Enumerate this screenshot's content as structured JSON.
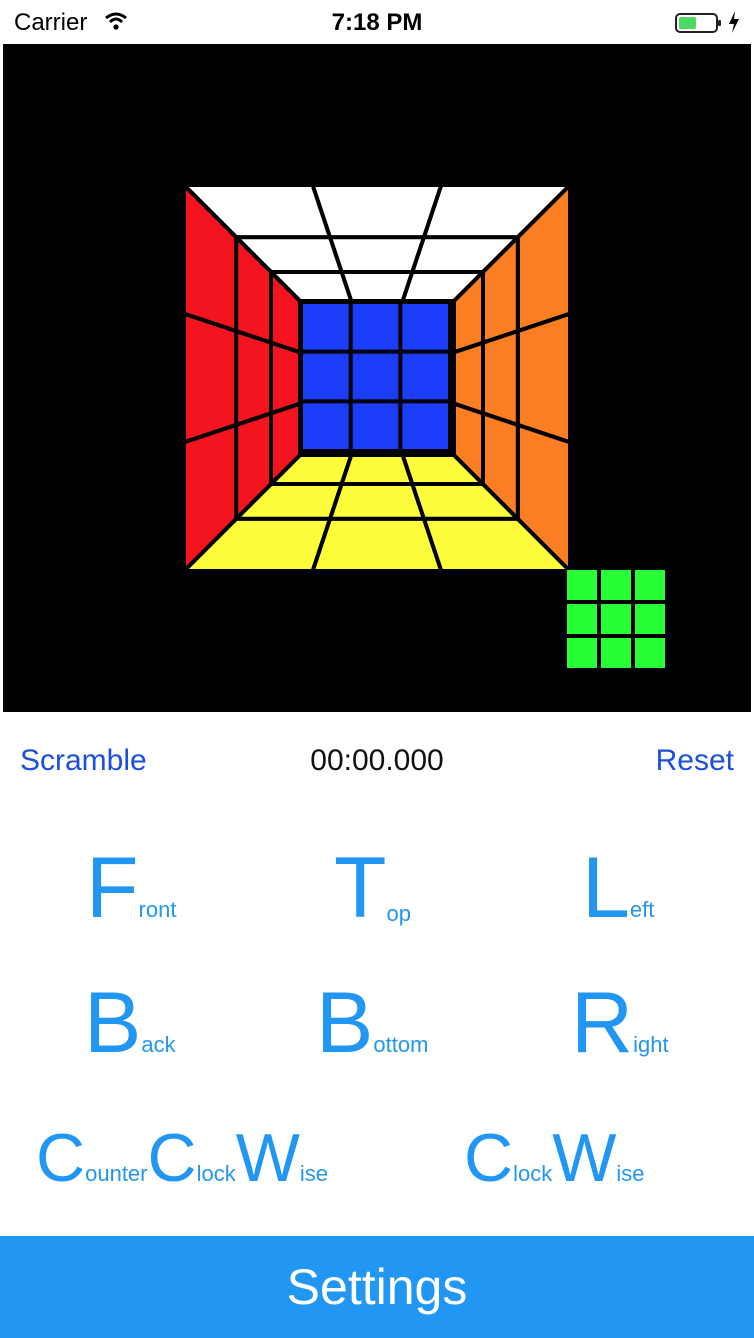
{
  "status_bar": {
    "carrier": "Carrier",
    "time": "7:18 PM"
  },
  "faces": {
    "top": "#ffffff",
    "left": "#f41420",
    "right": "#fb7f22",
    "bottom": "#fdfd3c",
    "center": "#1b3cf8",
    "mini": "#27fe35"
  },
  "controls": {
    "scramble": "Scramble",
    "timer": "00:00.000",
    "reset": "Reset"
  },
  "moves": {
    "front": {
      "big": "F",
      "small": "ront"
    },
    "top": {
      "big": "T",
      "small": "op"
    },
    "left": {
      "big": "L",
      "small": "eft"
    },
    "back": {
      "big": "B",
      "small": "ack"
    },
    "bottom": {
      "big": "B",
      "small": "ottom"
    },
    "right": {
      "big": "R",
      "small": "ight"
    },
    "counterclockwise": {
      "c1_big": "C",
      "c1_small": "ounter",
      "c2_big": "C",
      "c2_small": "lock",
      "w_big": "W",
      "w_small": "ise"
    },
    "clockwise": {
      "c_big": "C",
      "c_small": "lock",
      "w_big": "W",
      "w_small": "ise"
    }
  },
  "settings": "Settings"
}
